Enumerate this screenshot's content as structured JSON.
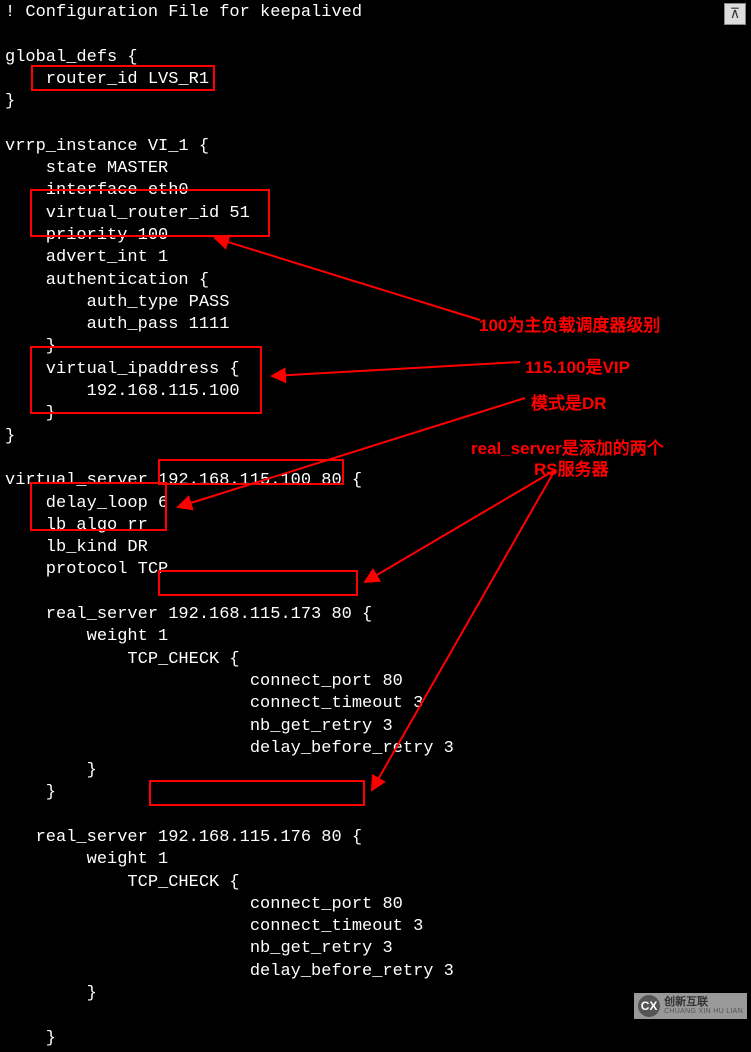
{
  "code": {
    "l1": "! Configuration File for keepalived",
    "l2": "",
    "l3": "global_defs {",
    "l4": "    router_id LVS_R1",
    "l5": "}",
    "l6": "",
    "l7": "vrrp_instance VI_1 {",
    "l8": "    state MASTER",
    "l9": "    interface eth0",
    "l10": "    virtual_router_id 51",
    "l11": "    priority 100",
    "l12": "    advert_int 1",
    "l13": "    authentication {",
    "l14": "        auth_type PASS",
    "l15": "        auth_pass 1111",
    "l16": "    }",
    "l17": "    virtual_ipaddress {",
    "l18": "        192.168.115.100",
    "l19": "    }",
    "l20": "}",
    "l21": "",
    "l22": "virtual_server 192.168.115.100 80 {",
    "l23": "    delay_loop 6",
    "l24": "    lb_algo rr",
    "l25": "    lb_kind DR",
    "l26": "    protocol TCP",
    "l27": "",
    "l28": "    real_server 192.168.115.173 80 {",
    "l29": "        weight 1",
    "l30": "            TCP_CHECK {",
    "l31": "                        connect_port 80",
    "l32": "                        connect_timeout 3",
    "l33": "                        nb_get_retry 3",
    "l34": "                        delay_before_retry 3",
    "l35": "        }",
    "l36": "    }",
    "l37": "",
    "l38": "   real_server 192.168.115.176 80 {",
    "l39": "        weight 1",
    "l40": "            TCP_CHECK {",
    "l41": "                        connect_port 80",
    "l42": "                        connect_timeout 3",
    "l43": "                        nb_get_retry 3",
    "l44": "                        delay_before_retry 3",
    "l45": "        }",
    "l46": "",
    "l47": "    }"
  },
  "annotations": {
    "a1": "100为主负载调度器级别",
    "a2": "115.100是VIP",
    "a3": "模式是DR",
    "a4_line1": "real_server是添加的两个",
    "a4_line2": "RS服务器"
  },
  "watermark": {
    "logo": "CX",
    "cn": "创新互联",
    "en": "CHUANG XIN HU LIAN"
  },
  "pin": "⊼"
}
